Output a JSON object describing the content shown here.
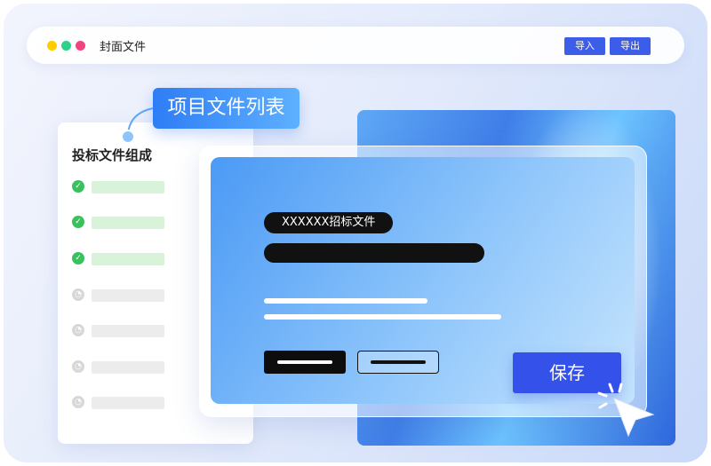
{
  "window": {
    "title": "封面文件",
    "import_label": "导入",
    "export_label": "导出"
  },
  "tooltip": {
    "label": "项目文件列表"
  },
  "sidebar": {
    "title": "投标文件组成",
    "items": [
      {
        "status": "complete"
      },
      {
        "status": "complete"
      },
      {
        "status": "complete"
      },
      {
        "status": "pending"
      },
      {
        "status": "pending"
      },
      {
        "status": "pending"
      },
      {
        "status": "pending"
      }
    ]
  },
  "editor": {
    "document_badge": "XXXXXX招标文件",
    "save_label": "保存"
  },
  "icons": {
    "complete": "check-circle-icon",
    "pending": "clock-icon",
    "pointer": "mouse-pointer-icon"
  },
  "colors": {
    "accent": "#3451ea",
    "complete": "#38c15c",
    "pending": "#d8d8d8"
  }
}
